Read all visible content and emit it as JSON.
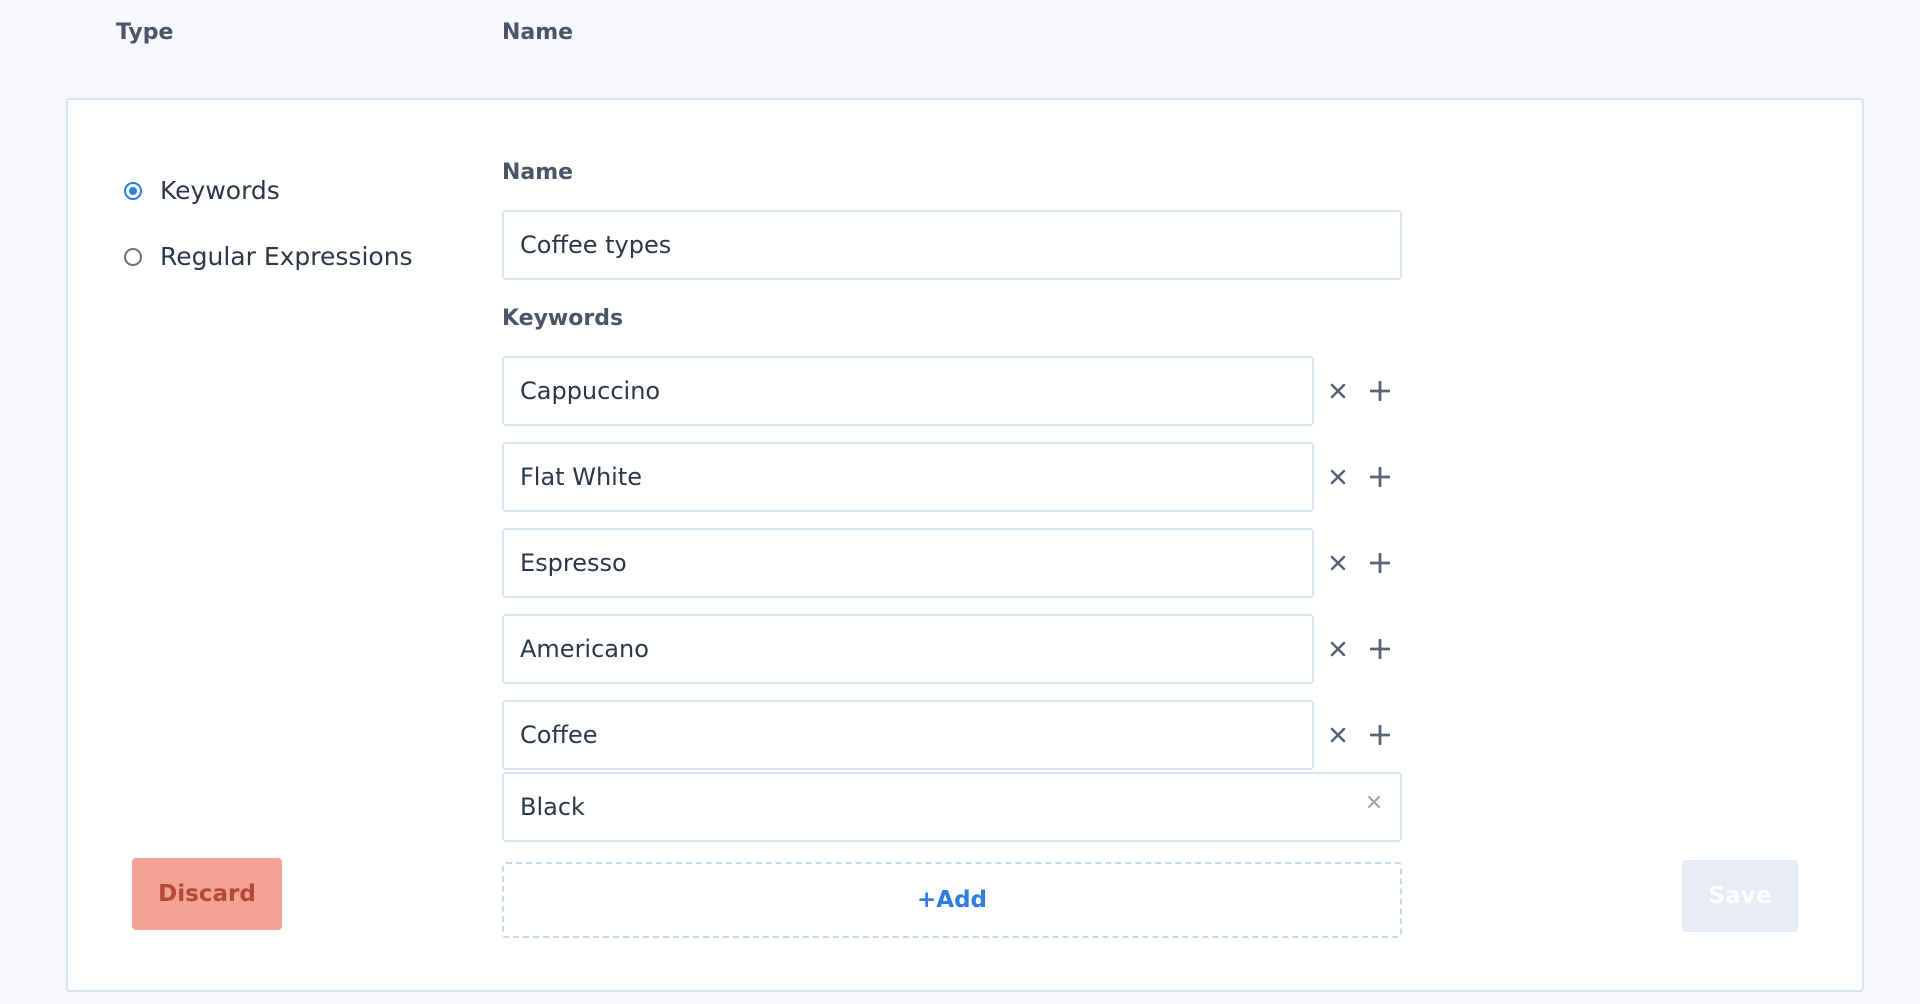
{
  "headers": {
    "type": "Type",
    "name": "Name"
  },
  "type_options": [
    {
      "label": "Keywords",
      "selected": true
    },
    {
      "label": "Regular Expressions",
      "selected": false
    }
  ],
  "form": {
    "name_label": "Name",
    "name_value": "Coffee types",
    "keywords_label": "Keywords",
    "keywords": [
      "Cappuccino",
      "Flat White",
      "Espresso",
      "Americano",
      "Coffee",
      "Black"
    ],
    "add_label": "+Add"
  },
  "actions": {
    "discard_label": "Discard",
    "save_label": "Save"
  },
  "icons": {
    "remove": "close-icon",
    "add": "plus-icon",
    "clear": "clear-icon"
  },
  "colors": {
    "accent": "#2f7de1",
    "discard_bg": "#f2a392",
    "discard_text": "#b3493a",
    "save_disabled_bg": "#e9edf5"
  }
}
